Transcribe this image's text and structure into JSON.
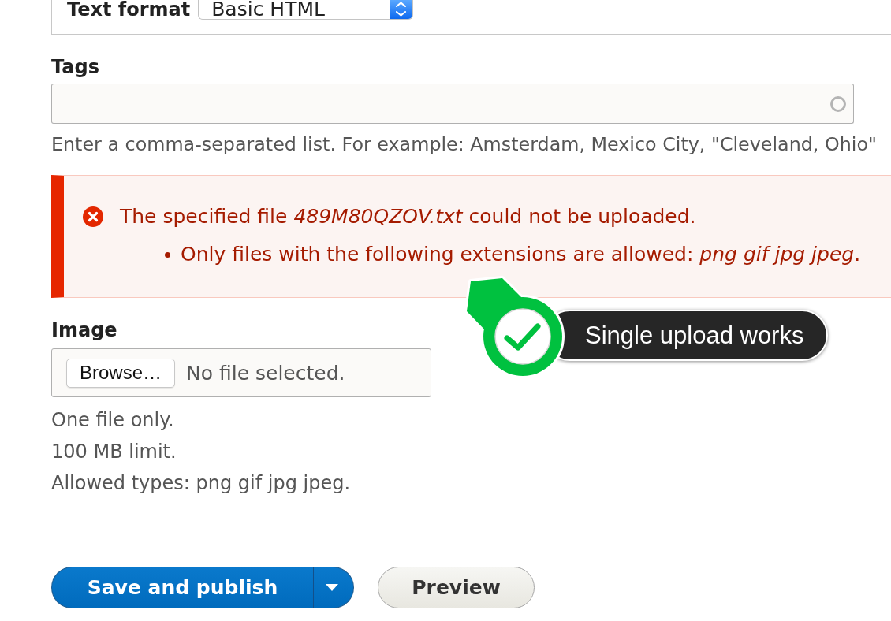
{
  "text_format": {
    "label": "Text format",
    "value": "Basic HTML"
  },
  "tags": {
    "label": "Tags",
    "description": "Enter a comma-separated list. For example: Amsterdam, Mexico City, \"Cleveland, Ohio\""
  },
  "message": {
    "kind": "error",
    "text": "The specified file *489M80QZOV.txt* could not be uploaded.",
    "items": [
      "Only files with the following extensions are allowed: *png gif jpg jpeg*."
    ]
  },
  "annotation": {
    "text": "Single upload works"
  },
  "image": {
    "label": "Image",
    "button": "Browse…",
    "status": "No file selected.",
    "descriptions": [
      "One file only.",
      "100 MB limit.",
      "Allowed types: png gif jpg jpeg."
    ]
  },
  "actions": [
    {
      "label": "Save and publish",
      "kind": "primary",
      "dropdown": true
    },
    {
      "label": "Preview",
      "kind": "secondary",
      "dropdown": false
    }
  ]
}
